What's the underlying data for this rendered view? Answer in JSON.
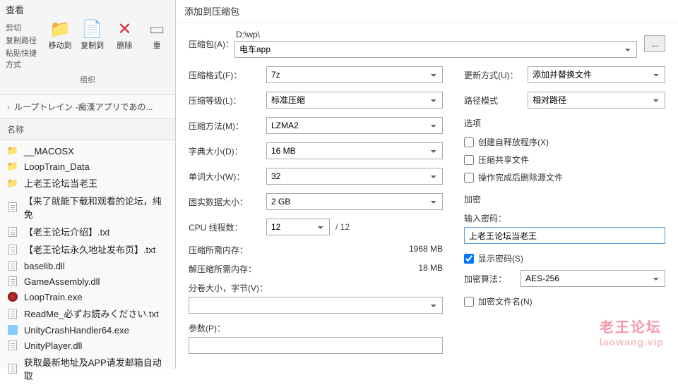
{
  "ribbon": {
    "view": "查看",
    "cut": "剪切",
    "copy_path": "复制路径",
    "paste_shortcut": "粘贴快捷方式",
    "move_to": "移动到",
    "copy_to": "复制到",
    "delete": "删除",
    "rename": "重",
    "group": "组织"
  },
  "breadcrumb": {
    "sep": "›",
    "item": "ループトレイン -痴漢アプリであの..."
  },
  "list_header": "名称",
  "files": [
    {
      "type": "folder",
      "label": "__MACOSX"
    },
    {
      "type": "folder",
      "label": "LoopTrain_Data"
    },
    {
      "type": "folder",
      "label": "上老王论坛当老王"
    },
    {
      "type": "doc",
      "label": "【来了就能下载和观看的论坛，纯免"
    },
    {
      "type": "doc",
      "label": "【老王论坛介绍】.txt"
    },
    {
      "type": "doc",
      "label": "【老王论坛永久地址发布页】.txt"
    },
    {
      "type": "doc",
      "label": "baselib.dll"
    },
    {
      "type": "doc",
      "label": "GameAssembly.dll"
    },
    {
      "type": "loop",
      "label": "LoopTrain.exe"
    },
    {
      "type": "doc",
      "label": "ReadMe_必ずお読みください.txt"
    },
    {
      "type": "exe",
      "label": "UnityCrashHandler64.exe"
    },
    {
      "type": "doc",
      "label": "UnityPlayer.dll"
    },
    {
      "type": "doc",
      "label": "获取最新地址及APP请发邮箱自动取"
    }
  ],
  "dialog": {
    "title": "添加到压缩包",
    "archive_label": "压缩包(A)：",
    "archive_path": "D:\\wp\\",
    "archive_name": "电车app",
    "browse": "...",
    "format_label": "压缩格式(F)：",
    "format_value": "7z",
    "level_label": "压缩等级(L)：",
    "level_value": "标准压缩",
    "method_label": "压缩方法(M)：",
    "method_value": "LZMA2",
    "dict_label": "字典大小(D)：",
    "dict_value": "16 MB",
    "word_label": "单词大小(W)：",
    "word_value": "32",
    "solid_label": "固实数据大小：",
    "solid_value": "2 GB",
    "cpu_label": "CPU 线程数：",
    "cpu_value": "12",
    "cpu_total": "/ 12",
    "mem_compress_label": "压缩所需内存：",
    "mem_compress_value": "1968 MB",
    "mem_decompress_label": "解压缩所需内存：",
    "mem_decompress_value": "18 MB",
    "split_label": "分卷大小，字节(V)：",
    "params_label": "参数(P)：",
    "update_label": "更新方式(U)：",
    "update_value": "添加并替换文件",
    "pathmode_label": "路径模式",
    "pathmode_value": "相对路径",
    "options_title": "选项",
    "opt_sfx": "创建自释放程序(X)",
    "opt_shared": "压缩共享文件",
    "opt_delete": "操作完成后删除源文件",
    "encrypt_title": "加密",
    "password_label": "输入密码：",
    "password_value": "上老王论坛当老王",
    "showpw": "显示密码(S)",
    "enc_method_label": "加密算法：",
    "enc_method_value": "AES-256",
    "enc_names": "加密文件名(N)"
  },
  "watermark": {
    "main": "老王论坛",
    "sub": "laowang.vip"
  }
}
